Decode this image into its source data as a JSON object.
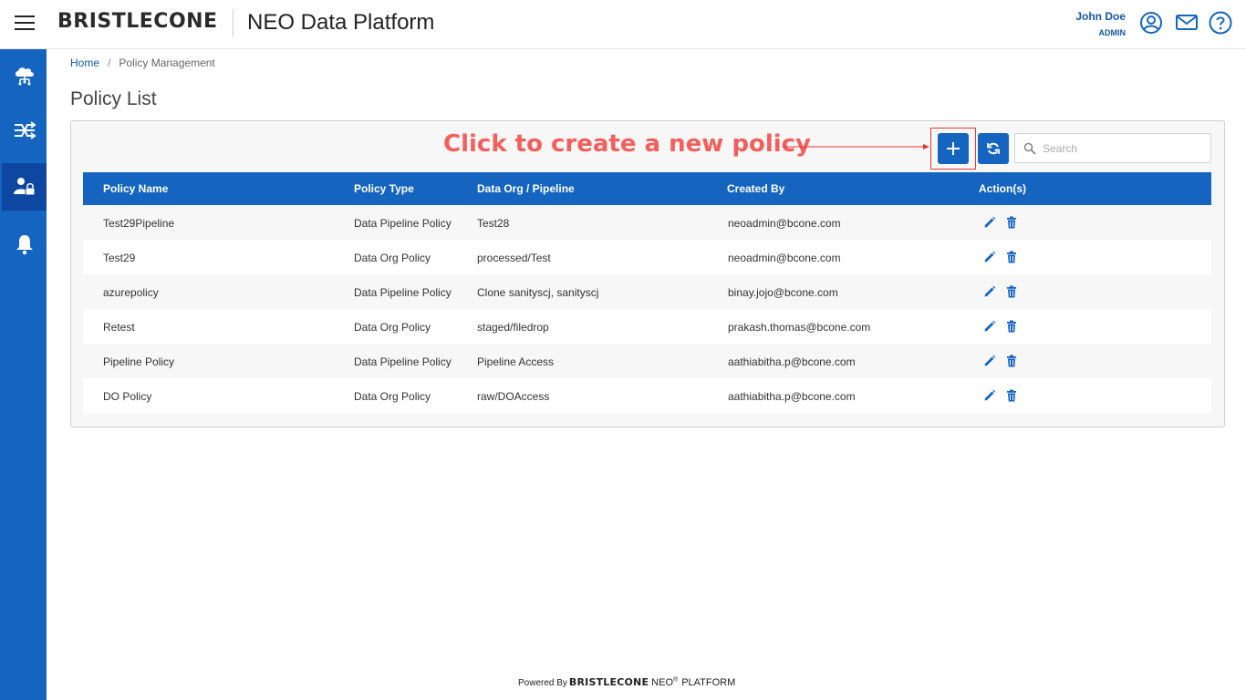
{
  "header": {
    "brand": "BRISTLECONE",
    "title": "NEO Data Platform",
    "user_name": "John Doe",
    "user_role": "ADMIN"
  },
  "sidebar": {
    "items": [
      {
        "icon": "cloud-network-icon",
        "active": false
      },
      {
        "icon": "pipeline-shuffle-icon",
        "active": false
      },
      {
        "icon": "user-lock-icon",
        "active": true
      },
      {
        "icon": "bell-icon",
        "active": false
      }
    ]
  },
  "breadcrumb": {
    "home": "Home",
    "separator": "/",
    "current": "Policy Management"
  },
  "page": {
    "title": "Policy List"
  },
  "annotation": {
    "text": "Click to create a new policy"
  },
  "toolbar": {
    "add_icon": "plus-icon",
    "refresh_icon": "refresh-icon",
    "search_placeholder": "Search",
    "search_value": ""
  },
  "table": {
    "columns": [
      "Policy Name",
      "Policy Type",
      "Data Org / Pipeline",
      "Created By",
      "Action(s)"
    ],
    "rows": [
      {
        "name": "Test29Pipeline",
        "type": "Data Pipeline Policy",
        "target": "Test28",
        "created_by": "neoadmin@bcone.com"
      },
      {
        "name": "Test29",
        "type": "Data Org Policy",
        "target": "processed/Test",
        "created_by": "neoadmin@bcone.com"
      },
      {
        "name": "azurepolicy",
        "type": "Data Pipeline Policy",
        "target": "Clone sanityscj, sanityscj",
        "created_by": "binay.jojo@bcone.com"
      },
      {
        "name": "Retest",
        "type": "Data Org Policy",
        "target": "staged/filedrop",
        "created_by": "prakash.thomas@bcone.com"
      },
      {
        "name": "Pipeline Policy",
        "type": "Data Pipeline Policy",
        "target": "Pipeline Access",
        "created_by": "aathiabitha.p@bcone.com"
      },
      {
        "name": "DO Policy",
        "type": "Data Org Policy",
        "target": "raw/DOAccess",
        "created_by": "aathiabitha.p@bcone.com"
      }
    ]
  },
  "footer": {
    "powered_by": "Powered By",
    "brand": "BRISTLECONE",
    "neo": "NEO",
    "registered": "®",
    "platform": "PLATFORM"
  },
  "colors": {
    "primary": "#1565c0",
    "sidebar_active": "#0d47a1",
    "annotation": "#f25f5c",
    "link": "#1458a8"
  }
}
